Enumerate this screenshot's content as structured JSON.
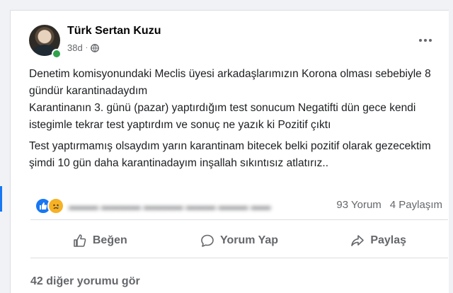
{
  "post": {
    "author": "Türk Sertan Kuzu",
    "time": "38d",
    "separator": "·",
    "paragraphs": [
      "Denetim komisyonundaki Meclis üyesi arkadaşlarımızın Korona olması sebebiyle 8 gündür karantinadaydım\nKarantinanın 3. günü (pazar) yaptırdığım test sonucum Negatifti dün gece kendi istegimle tekrar test yaptırdım ve sonuç ne yazık ki Pozitif çıktı",
      "Test yaptırmamış olsaydım yarın karantinam bitecek belki pozitif olarak gezecektim şimdi 10 gün daha karantinadayım inşallah sıkıntısız atlatırız.."
    ]
  },
  "stats": {
    "comments": "93 Yorum",
    "shares": "4 Paylaşım",
    "reactions": [
      "like",
      "sad"
    ]
  },
  "actions": {
    "like": "Beğen",
    "comment": "Yorum Yap",
    "share": "Paylaş"
  },
  "comments": {
    "more_label": "42 diğer yorumu gör"
  },
  "colors": {
    "accent": "#1877f2",
    "online": "#31a24c",
    "sad": "#f7b125",
    "muted": "#65676b"
  }
}
